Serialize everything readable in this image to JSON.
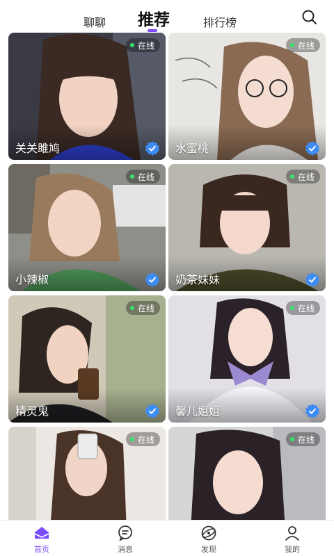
{
  "top_tabs": [
    {
      "label": "聊聊",
      "active": false
    },
    {
      "label": "推荐",
      "active": true
    },
    {
      "label": "排行榜",
      "active": false
    }
  ],
  "search_icon": "search-icon",
  "accent_color": "#7b4dff",
  "online_dot_color": "#37e36a",
  "verified_color": "#3d8cf5",
  "cards": [
    {
      "name": "关关雎鸠",
      "status": "在线",
      "verified": true
    },
    {
      "name": "水蜜桃",
      "status": "在线",
      "verified": true
    },
    {
      "name": "小辣椒",
      "status": "在线",
      "verified": true
    },
    {
      "name": "奶茶妹妹",
      "status": "在线",
      "verified": true
    },
    {
      "name": "精灵鬼",
      "status": "在线",
      "verified": true
    },
    {
      "name": "馨儿姐姐",
      "status": "在线",
      "verified": true
    },
    {
      "name": "",
      "status": "在线",
      "verified": false
    },
    {
      "name": "",
      "status": "在线",
      "verified": false
    }
  ],
  "bottom_nav": [
    {
      "label": "首页",
      "icon": "home-icon",
      "active": true
    },
    {
      "label": "消息",
      "icon": "message-icon",
      "active": false
    },
    {
      "label": "发现",
      "icon": "discover-icon",
      "active": false
    },
    {
      "label": "我的",
      "icon": "profile-icon",
      "active": false
    }
  ]
}
